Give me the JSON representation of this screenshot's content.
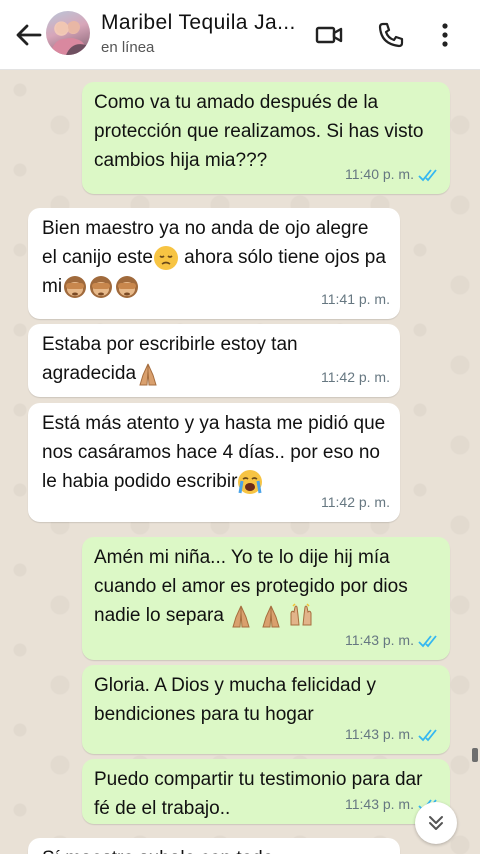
{
  "header": {
    "contact_name": "Maribel Tequila Ja...",
    "status": "en línea",
    "back_icon": "arrow-left-icon",
    "video_icon": "video-call-icon",
    "phone_icon": "phone-icon",
    "more_icon": "more-vertical-icon"
  },
  "colors": {
    "outgoing": "#dcf8c6",
    "incoming": "#ffffff",
    "read_ticks": "#34b7f1",
    "chat_bg": "#e9e1d6"
  },
  "messages": [
    {
      "direction": "out",
      "text": "Como va tu amado después de la protección que realizamos. Si has visto cambios hija mia???",
      "time": "11:40 p. m.",
      "read": true
    },
    {
      "direction": "in",
      "text_parts": [
        "Bien maestro ya no anda de ojo alegre el canijo este",
        " ahora sólo tiene ojos pa mi"
      ],
      "emojis": [
        "pensive-face",
        "see-no-evil-monkey",
        "see-no-evil-monkey",
        "see-no-evil-monkey"
      ],
      "time": "11:41 p. m."
    },
    {
      "direction": "in",
      "text": "Estaba por escribirle estoy tan agradecida",
      "emojis": [
        "folded-hands"
      ],
      "time": "11:42 p. m."
    },
    {
      "direction": "in",
      "text": "Está más atento y ya hasta me pidió que nos casáramos hace 4 días.. por eso no le habia podido escribir",
      "emojis": [
        "loudly-crying-face"
      ],
      "time": "11:42 p. m."
    },
    {
      "direction": "out",
      "text": "Amén mi niña... Yo te lo dije hij mía cuando el amor es protegido por dios nadie lo separa",
      "emojis": [
        "folded-hands",
        "folded-hands",
        "raising-hands"
      ],
      "time": "11:43 p. m.",
      "read": true
    },
    {
      "direction": "out",
      "text": "Gloria. A Dios y mucha felicidad y bendiciones para tu hogar",
      "time": "11:43 p. m.",
      "read": true
    },
    {
      "direction": "out",
      "text": "Puedo compartir tu testimonio para dar fé de el trabajo..",
      "time": "11:43 p. m.",
      "read": true
    }
  ],
  "partial_message": "Sí maestro subalo con todo",
  "scroll_down_icon": "double-chevron-down-icon"
}
